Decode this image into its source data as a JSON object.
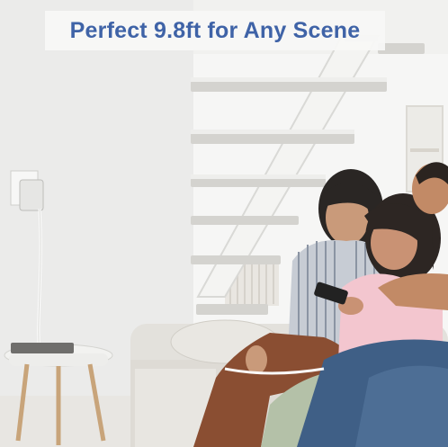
{
  "banner": {
    "headline": "Perfect 9.8ft for Any Scene"
  },
  "colors": {
    "headline_text": "#3f63a7",
    "banner_background": "#f7f7f6",
    "wall": "#efefed",
    "sofa": "#e4e1dc"
  }
}
